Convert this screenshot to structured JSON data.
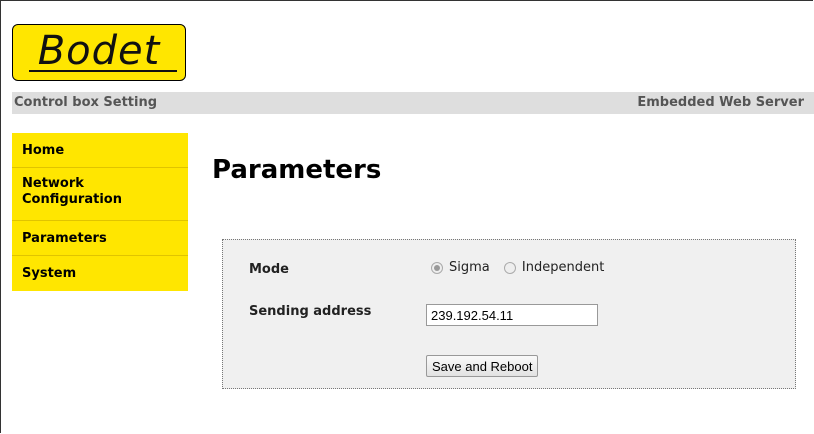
{
  "brand": {
    "logo_text": "Bodet",
    "accent_color": "#ffe600"
  },
  "header": {
    "left_title": "Control box Setting",
    "right_title": "Embedded Web Server"
  },
  "sidebar": {
    "items": [
      {
        "label": "Home"
      },
      {
        "label": "Network Configuration"
      },
      {
        "label": "Parameters"
      },
      {
        "label": "System"
      }
    ]
  },
  "main": {
    "title": "Parameters",
    "form": {
      "mode_label": "Mode",
      "mode_options": [
        {
          "label": "Sigma",
          "checked": true
        },
        {
          "label": "Independent",
          "checked": false
        }
      ],
      "sending_address_label": "Sending address",
      "sending_address_value": "239.192.54.11",
      "submit_label": "Save and Reboot"
    }
  }
}
